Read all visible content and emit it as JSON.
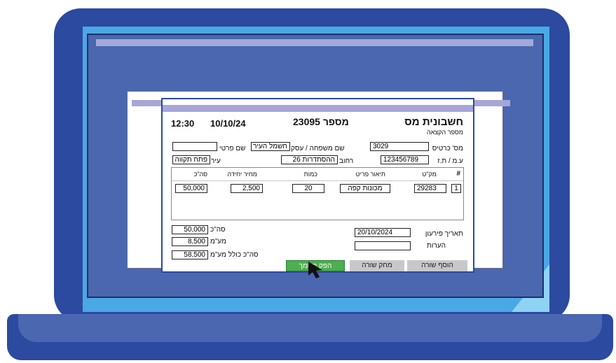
{
  "form": {
    "title": "חשבונית מס",
    "subtitle": "מספר הקצאה",
    "number_label": "מספר 23095",
    "date": "10/10/24",
    "time": "12:30",
    "card_no": {
      "label": "מס' כרטיס",
      "value": "3029"
    },
    "family_name": {
      "label": "שם משפחה / עסק",
      "value": "חשמל העיר"
    },
    "first_name": {
      "label": "שם פרטי",
      "value": ""
    },
    "id_no": {
      "label": "ע.מ / ת.ז",
      "value": "123456789"
    },
    "street": {
      "label": "רחוב",
      "value": "ההסתדרות 26"
    },
    "city": {
      "label": "עיר",
      "value": "פתח תקווה"
    },
    "columns": [
      "#",
      "מק\"ט",
      "תיאור פריט",
      "כמות",
      "מחיר יחידה",
      "סה\"כ"
    ],
    "rows": [
      {
        "num": "1",
        "sku": "29283",
        "desc": "מכונות קפה",
        "qty": "20",
        "unit_price": "2,500",
        "total": "50,000"
      }
    ],
    "due_date": {
      "label": "תאריך פירעון",
      "value": "20/10/2024"
    },
    "notes": {
      "label": "הערות",
      "value": ""
    },
    "subtotal": {
      "label": "סה\"כ",
      "value": "50,000"
    },
    "vat": {
      "label": "מע\"מ",
      "value": "8,500"
    },
    "grand_total": {
      "label": "סה\"כ כולל מע\"מ",
      "value": "58,500"
    },
    "buttons": {
      "add_row": "הוסף שורה",
      "delete_row": "מחק שורה",
      "produce": "הפק מסמך"
    }
  },
  "colors": {
    "frame": "#2b4aa0",
    "screen": "#4aa8e4",
    "desktop": "#4a67b0",
    "titlebar": "#a6a6d8",
    "produce_button": "#4caf50"
  }
}
